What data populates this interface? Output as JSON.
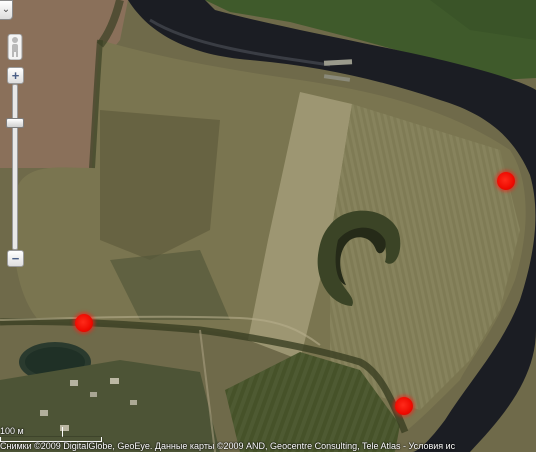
{
  "map": {
    "scale": {
      "label": "100 м"
    },
    "attribution": {
      "text": "Снимки ©2009 DigitalGlobe, GeoEye. Данные карты ©2009 AND, Geocentre Consulting, Tele Atlas -",
      "terms_link": "Условия ис"
    },
    "controls": {
      "pan_glyph": "⌄",
      "zoom_in": "+",
      "zoom_out": "−",
      "zoom_level_fraction": 0.2
    },
    "markers": [
      {
        "id": "marker-east"
      },
      {
        "id": "marker-west"
      },
      {
        "id": "marker-south"
      }
    ],
    "colors": {
      "marker": "#ee0a00",
      "river": "#1a1c22",
      "field": "#7f7a52"
    }
  }
}
